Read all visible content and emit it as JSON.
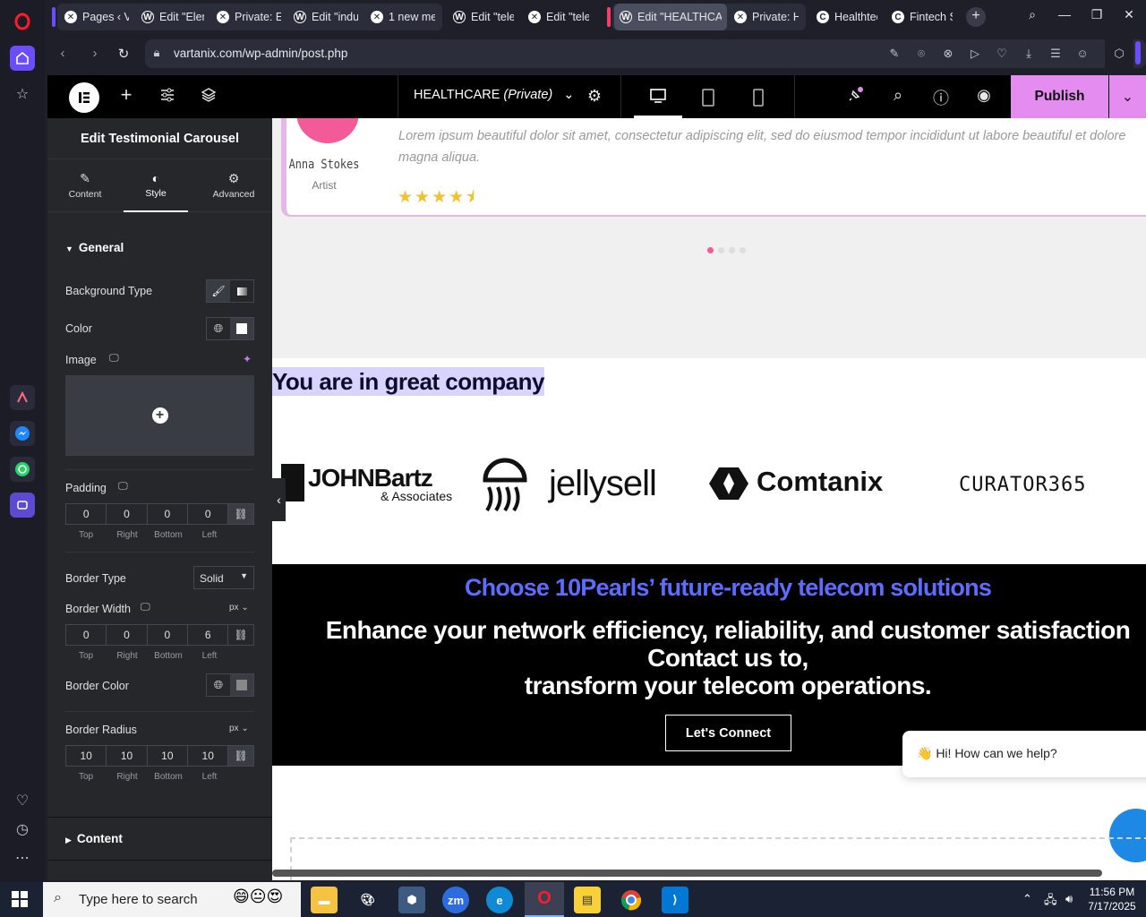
{
  "browser": {
    "tabs": [
      {
        "label": "Pages ‹ Va",
        "icon": "elementor-x-icon"
      },
      {
        "label": "Edit \"Elem",
        "icon": "wordpress-icon"
      },
      {
        "label": "Private: El",
        "icon": "elementor-x-icon"
      },
      {
        "label": "Edit \"indu",
        "icon": "wordpress-icon"
      },
      {
        "label": "1 new mes",
        "icon": "elementor-x-icon"
      },
      {
        "label": "Edit \"telec",
        "icon": "wordpress-icon"
      },
      {
        "label": "Edit \"telec",
        "icon": "elementor-x-icon"
      },
      {
        "label": "Edit \"HEALTHCARE",
        "icon": "wordpress-icon",
        "active": true
      },
      {
        "label": "Private: HE",
        "icon": "elementor-x-icon"
      },
      {
        "label": "Healthtech",
        "icon": "c-icon"
      },
      {
        "label": "Fintech So",
        "icon": "c-icon"
      }
    ],
    "url": "vartanix.com/wp-admin/post.php"
  },
  "editor": {
    "page_title": "HEALTHCARE",
    "page_status": "(Private)",
    "publish_label": "Publish"
  },
  "panel": {
    "title": "Edit Testimonial Carousel",
    "tabs": [
      {
        "label": "Content",
        "icon": "pencil-icon"
      },
      {
        "label": "Style",
        "icon": "half-circle-icon",
        "active": true
      },
      {
        "label": "Advanced",
        "icon": "gear-icon"
      }
    ],
    "section_general": "General",
    "background_type_label": "Background Type",
    "color_label": "Color",
    "image_label": "Image",
    "padding_label": "Padding",
    "padding_values": [
      "0",
      "0",
      "0",
      "0"
    ],
    "side_labels": [
      "Top",
      "Right",
      "Bottom",
      "Left"
    ],
    "border_type_label": "Border Type",
    "border_type_value": "Solid",
    "border_width_label": "Border Width",
    "border_width_unit": "px",
    "border_width_values": [
      "0",
      "0",
      "0",
      "6"
    ],
    "border_color_label": "Border Color",
    "border_radius_label": "Border Radius",
    "border_radius_unit": "px",
    "border_radius_values": [
      "10",
      "10",
      "10",
      "10"
    ],
    "section_content": "Content"
  },
  "canvas": {
    "testimonial": {
      "name": "Anna Stokes",
      "role": "Artist",
      "text": "Lorem ipsum beautiful dolor sit amet, consectetur adipiscing elit, sed do eiusmod tempor incididunt ut labore beautiful et dolore magna aliqua.",
      "stars": "★★★★⯨",
      "rating": 4.5
    },
    "company_heading": "You are in great company",
    "logos": [
      {
        "name": "JOHNBartz",
        "sub": "& Associates"
      },
      {
        "name": "jellysell"
      },
      {
        "name": "Comtanix"
      },
      {
        "name": "CURATOR365"
      }
    ],
    "cta": {
      "heading": "Choose 10Pearls’ future-ready telecom solutions",
      "line1": "Enhance your network efficiency, reliability, and customer satisfaction",
      "line2": "Contact us to,",
      "line3": "transform your telecom operations.",
      "button": "Let's Connect"
    },
    "chat_bubble": "👋 Hi! How can we help?"
  },
  "taskbar": {
    "search_placeholder": "Type here to search",
    "time": "11:56 PM",
    "date": "7/17/2025"
  },
  "colors": {
    "accent_purple": "#e58cf0",
    "cta_blue": "#5b6cff",
    "pink_border": "#e3b7e8",
    "star": "#f2c12e",
    "avatar": "#f25b98"
  }
}
